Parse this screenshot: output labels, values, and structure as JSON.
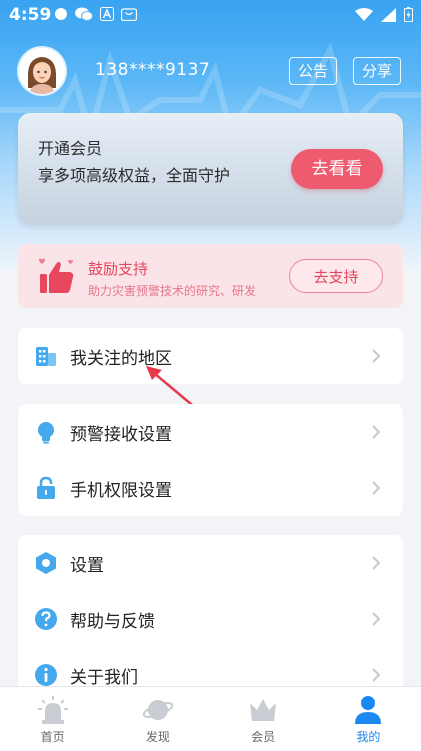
{
  "status_bar": {
    "time": "4:59"
  },
  "profile": {
    "phone": "138****9137",
    "notice_label": "公告",
    "share_label": "分享"
  },
  "member_card": {
    "title": "开通会员",
    "description": "享多项高级权益，全面守护",
    "button_label": "去看看"
  },
  "support_card": {
    "title": "鼓励支持",
    "description": "助力灾害预警技术的研究、研发",
    "button_label": "去支持"
  },
  "menu_groups": [
    {
      "items": [
        {
          "label": "我关注的地区",
          "icon": "buildings-icon"
        }
      ]
    },
    {
      "items": [
        {
          "label": "预警接收设置",
          "icon": "lightbulb-icon"
        },
        {
          "label": "手机权限设置",
          "icon": "lock-icon"
        }
      ]
    },
    {
      "items": [
        {
          "label": "设置",
          "icon": "hexagon-settings-icon"
        },
        {
          "label": "帮助与反馈",
          "icon": "question-icon"
        },
        {
          "label": "关于我们",
          "icon": "info-icon"
        }
      ]
    }
  ],
  "bottom_nav": [
    {
      "label": "首页",
      "icon": "alarm-light-icon",
      "active": false
    },
    {
      "label": "发现",
      "icon": "planet-icon",
      "active": false
    },
    {
      "label": "会员",
      "icon": "crown-icon",
      "active": false
    },
    {
      "label": "我的",
      "icon": "person-icon",
      "active": true
    }
  ],
  "colors": {
    "header_blue": "#38a3f2",
    "accent_red": "#ee5b6f",
    "active_blue": "#1a88f0"
  }
}
